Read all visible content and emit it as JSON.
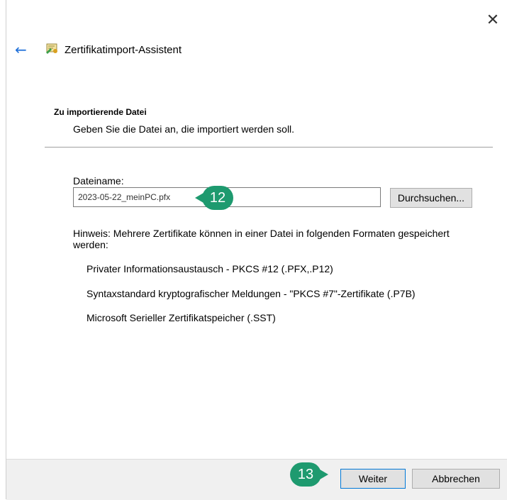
{
  "window": {
    "close_glyph": "✕",
    "back_glyph": "←",
    "title": "Zertifikatimport-Assistent",
    "icon": "certificate-icon"
  },
  "section": {
    "heading": "Zu importierende Datei",
    "description": "Geben Sie die Datei an, die importiert werden soll."
  },
  "file": {
    "label": "Dateiname:",
    "value": "2023-05-22_meinPC.pfx",
    "browse_label": "Durchsuchen..."
  },
  "hint": "Hinweis: Mehrere Zertifikate können in einer Datei in folgenden Formaten gespeichert werden:",
  "formats": [
    "Privater Informationsaustausch - PKCS #12 (.PFX,.P12)",
    "Syntaxstandard kryptografischer Meldungen - \"PKCS #7\"-Zertifikate (.P7B)",
    "Microsoft Serieller Zertifikatspeicher (.SST)"
  ],
  "footer": {
    "next_label": "Weiter",
    "cancel_label": "Abbrechen"
  },
  "annotations": {
    "step_a": "12",
    "step_b": "13",
    "color": "#1e9a6f"
  }
}
